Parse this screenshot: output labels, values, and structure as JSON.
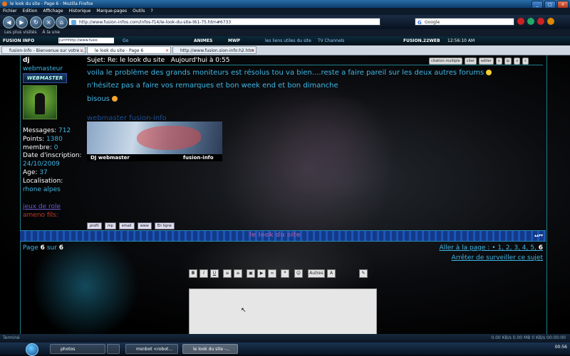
{
  "window": {
    "title": "le look du site - Page 6 - Mozilla Firefox"
  },
  "menu": [
    "Fichier",
    "Edition",
    "Affichage",
    "Historique",
    "Marque-pages",
    "Outils",
    "?"
  ],
  "nav": {
    "url": "http://www.fusion-infos.com/infos-f14/le-look-du-site-t61-75.htm#6733",
    "search_engine": "Google"
  },
  "bookmarks": [
    "Les plus visités",
    "À la une"
  ],
  "toolbar2": {
    "items": [
      "FUSION INFO",
      "Go",
      "ANIMES",
      "MWP",
      "les liens utiles du site",
      "TV Channels",
      "FUSION.22WEB"
    ],
    "url_field": "{url=http://www.fusio",
    "clock": "12:56:10 AM"
  },
  "tabs": [
    {
      "label": "fusion-info - Bienvenue sur votre ..."
    },
    {
      "label": "le look du site - Page 6"
    },
    {
      "label": "http://www.fusion.sion-info:h2.htm"
    }
  ],
  "user": {
    "name": "dj",
    "rank": "webmasteur",
    "badge": "WEBMASTER",
    "stats": [
      {
        "label": "Messages:",
        "value": "712"
      },
      {
        "label": "Points:",
        "value": "1380"
      },
      {
        "label": "membre:",
        "value": "0"
      },
      {
        "label": "Date d'inscription:",
        "value": "24/10/2009"
      },
      {
        "label": "Age:",
        "value": "37"
      },
      {
        "label": "Localisation:",
        "value": "rhone alpes"
      }
    ],
    "role_link": "jeux de role",
    "friends_link": "ameno fils:"
  },
  "post": {
    "subject": "Sujet: Re: le look du site",
    "date": "Aujourd'hui à 0:55",
    "buttons": [
      "citation multiple",
      "citer",
      "editer",
      "x",
      "ip",
      "x",
      "c"
    ],
    "lines": [
      "voila le problème des grands moniteurs est résolus tou va bien....reste a faire pareil sur les deux autres forums",
      "n'hésitez pas a faire vos remarques et bon week end et bon dimanche",
      "bisous"
    ],
    "signature_title": "webmaster fusion-info",
    "banner_left": "DJ webmaster",
    "banner_right": "fusion-info",
    "profile_buttons": [
      "profil",
      "mp",
      "email",
      "www",
      "En ligne"
    ]
  },
  "topic_bar": {
    "title": "le look du site"
  },
  "pager": {
    "prefix": "Page",
    "current": "6",
    "sep": "sur",
    "total": "6",
    "goto_label": "Aller à la page :",
    "pages": [
      "1",
      "2",
      "3",
      "4",
      "5"
    ],
    "last": "6",
    "unwatch": "Arrêter de surveiller ce sujet"
  },
  "editor": {
    "buttons": [
      "B",
      "I",
      "U",
      "",
      "",
      "",
      "",
      "",
      "",
      "",
      "",
      "",
      "Autres",
      ""
    ]
  },
  "status": {
    "left": "Terminé",
    "right": "0.00 KB/s  0.00 MB  0 KB/s  00:00:00"
  },
  "taskbar": {
    "items": [
      "photos",
      "",
      "msnbot <robot...",
      "le look du site -..."
    ],
    "clock": "00:56"
  }
}
